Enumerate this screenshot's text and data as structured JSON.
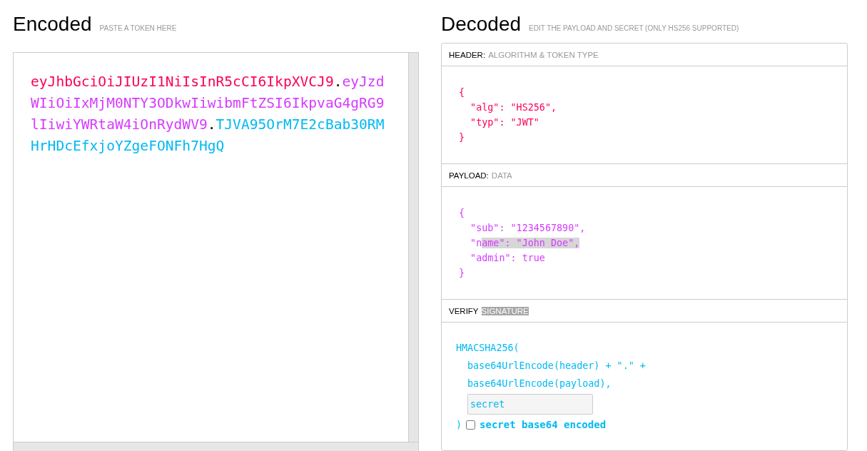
{
  "encoded": {
    "title": "Encoded",
    "hint": "PASTE A TOKEN HERE",
    "token": [
      {
        "kind": "header",
        "text": "eyJhbGciOiJIUzI1NiIsInR5cCI6IkpXVCJ9"
      },
      {
        "kind": "dot",
        "text": "."
      },
      {
        "kind": "payload",
        "text": "eyJzdWIiOiIxMjM0NTY3ODkwIiwibmFtZSI6IkpvaG4gRG9lIiwiYWRtaW4iOnRydWV9"
      },
      {
        "kind": "dot",
        "text": "."
      },
      {
        "kind": "signature",
        "text": "TJVA95OrM7E2cBab30RMHrHDcEfxjoYZgeFONFh7HgQ"
      }
    ]
  },
  "decoded": {
    "title": "Decoded",
    "hint": "EDIT THE PAYLOAD AND SECRET (ONLY HS256 SUPPORTED)",
    "sections": [
      {
        "kind": "header",
        "label": "HEADER:",
        "sublabel": "ALGORITHM & TOKEN TYPE",
        "sublabel_selected": false,
        "lines": [
          [
            {
              "text": "{",
              "selected": false
            }
          ],
          [
            {
              "text": "  \"alg\": \"HS256\",",
              "selected": false
            }
          ],
          [
            {
              "text": "  \"typ\": \"JWT\"",
              "selected": false
            }
          ],
          [
            {
              "text": "}",
              "selected": false
            }
          ]
        ]
      },
      {
        "kind": "payload",
        "label": "PAYLOAD:",
        "sublabel": "DATA",
        "sublabel_selected": false,
        "lines": [
          [
            {
              "text": "{",
              "selected": false
            }
          ],
          [
            {
              "text": "  \"sub\": \"1234567890\",",
              "selected": false
            }
          ],
          [
            {
              "text": "  \"n",
              "selected": false
            },
            {
              "text": "ame\": \"John Doe\",",
              "selected": true
            }
          ],
          [
            {
              "text": "  \"admin\": true",
              "selected": false
            }
          ],
          [
            {
              "text": "}",
              "selected": false
            }
          ]
        ]
      },
      {
        "kind": "signature",
        "label": "VERIFY",
        "sublabel": "SIGNATURE",
        "sublabel_selected": true,
        "function": "HMACSHA256(",
        "args": [
          "base64UrlEncode(header) + \".\" +",
          "base64UrlEncode(payload),"
        ],
        "secret": {
          "value": "secret"
        },
        "close": ")",
        "base64": {
          "label": "secret base64 encoded",
          "checked": false
        }
      }
    ]
  }
}
